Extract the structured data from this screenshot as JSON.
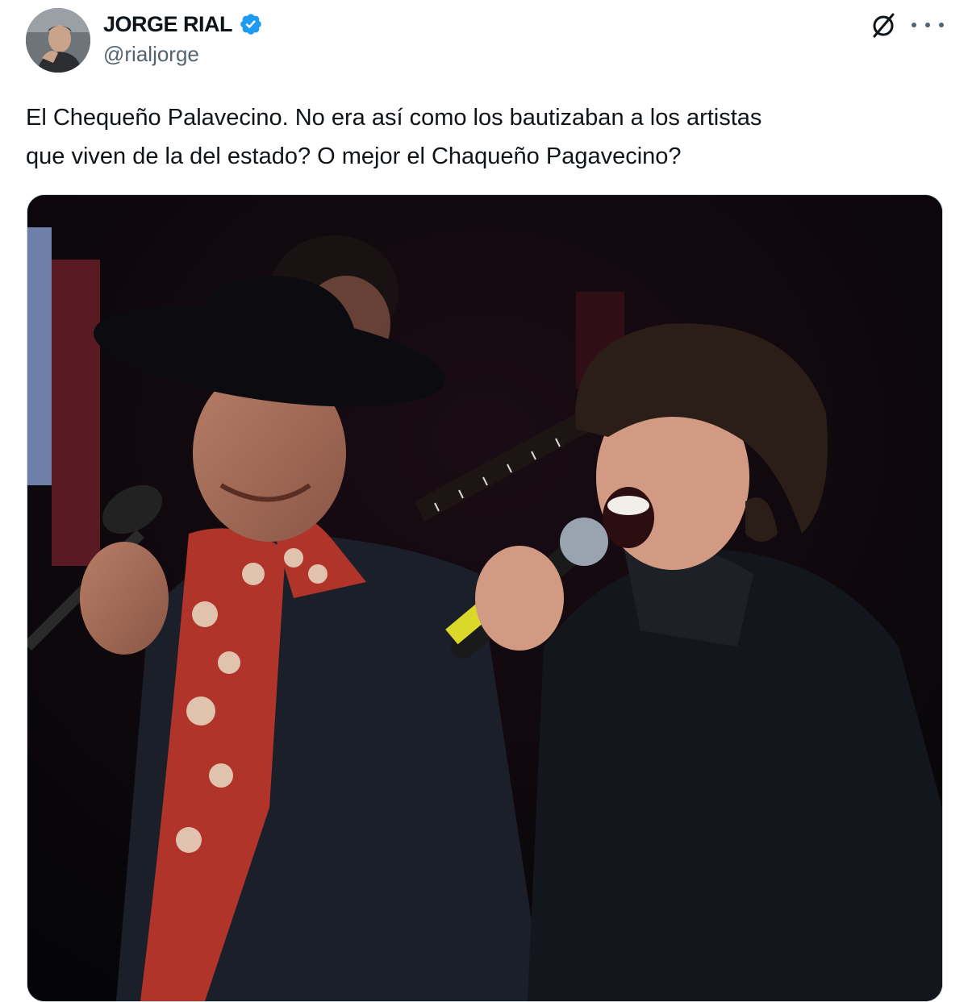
{
  "author": {
    "display_name": "JORGE RIAL",
    "handle": "@rialjorge",
    "verified_icon": "verified-badge-icon",
    "badge_color": "#1d9bf0"
  },
  "actions": {
    "grok_icon": "grok-icon",
    "more_icon": "more-options-icon"
  },
  "tweet": {
    "text_line1": "El Chequeño Palavecino. No era así como los bautizaban a los artistas",
    "text_line2": "que viven de la del estado? O mejor el Chaqueño Pagavecino?"
  },
  "media": {
    "type": "photo"
  },
  "colors": {
    "text": "#0f1419",
    "secondary": "#536471",
    "accent": "#1d9bf0"
  }
}
